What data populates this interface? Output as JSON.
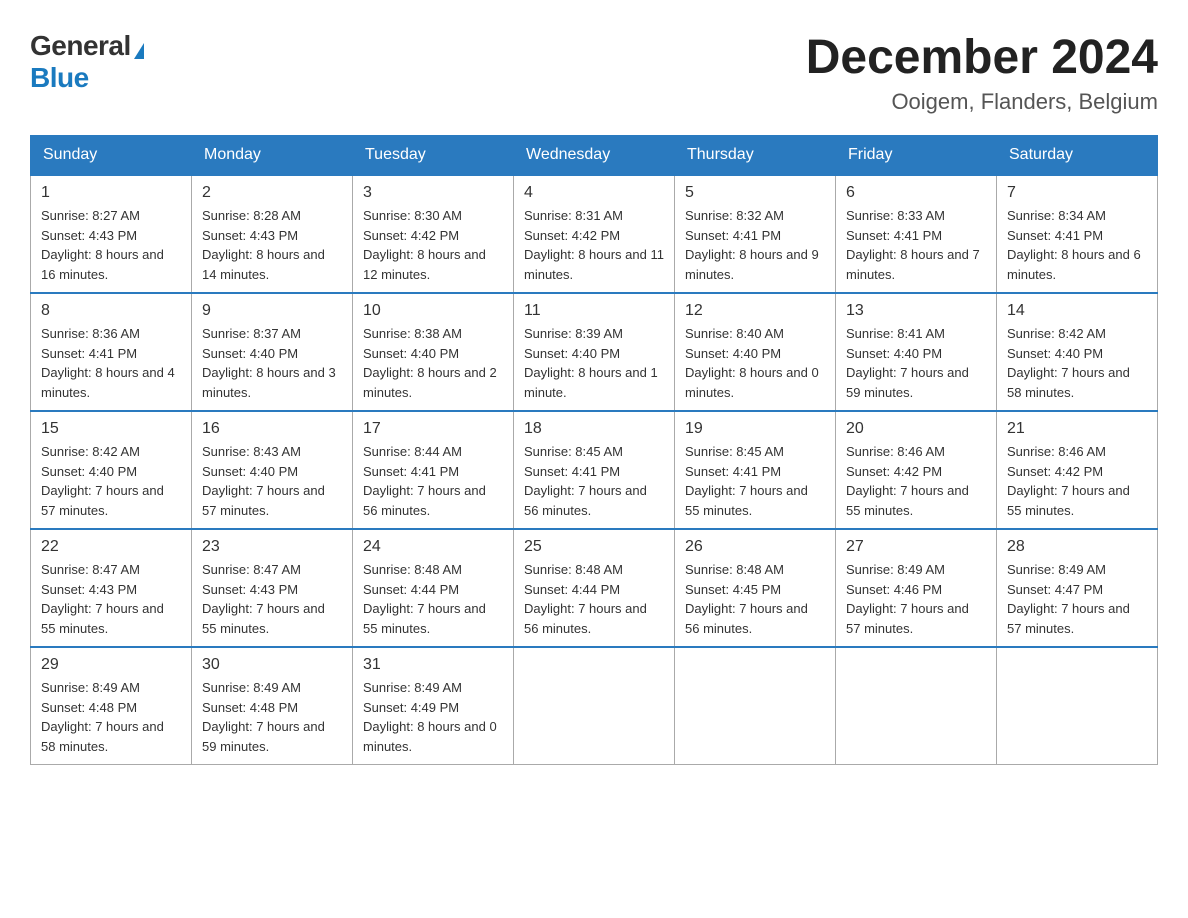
{
  "logo": {
    "general": "General",
    "blue": "Blue"
  },
  "header": {
    "title": "December 2024",
    "location": "Ooigem, Flanders, Belgium"
  },
  "weekdays": [
    "Sunday",
    "Monday",
    "Tuesday",
    "Wednesday",
    "Thursday",
    "Friday",
    "Saturday"
  ],
  "weeks": [
    [
      {
        "day": "1",
        "sunrise": "8:27 AM",
        "sunset": "4:43 PM",
        "daylight": "8 hours and 16 minutes."
      },
      {
        "day": "2",
        "sunrise": "8:28 AM",
        "sunset": "4:43 PM",
        "daylight": "8 hours and 14 minutes."
      },
      {
        "day": "3",
        "sunrise": "8:30 AM",
        "sunset": "4:42 PM",
        "daylight": "8 hours and 12 minutes."
      },
      {
        "day": "4",
        "sunrise": "8:31 AM",
        "sunset": "4:42 PM",
        "daylight": "8 hours and 11 minutes."
      },
      {
        "day": "5",
        "sunrise": "8:32 AM",
        "sunset": "4:41 PM",
        "daylight": "8 hours and 9 minutes."
      },
      {
        "day": "6",
        "sunrise": "8:33 AM",
        "sunset": "4:41 PM",
        "daylight": "8 hours and 7 minutes."
      },
      {
        "day": "7",
        "sunrise": "8:34 AM",
        "sunset": "4:41 PM",
        "daylight": "8 hours and 6 minutes."
      }
    ],
    [
      {
        "day": "8",
        "sunrise": "8:36 AM",
        "sunset": "4:41 PM",
        "daylight": "8 hours and 4 minutes."
      },
      {
        "day": "9",
        "sunrise": "8:37 AM",
        "sunset": "4:40 PM",
        "daylight": "8 hours and 3 minutes."
      },
      {
        "day": "10",
        "sunrise": "8:38 AM",
        "sunset": "4:40 PM",
        "daylight": "8 hours and 2 minutes."
      },
      {
        "day": "11",
        "sunrise": "8:39 AM",
        "sunset": "4:40 PM",
        "daylight": "8 hours and 1 minute."
      },
      {
        "day": "12",
        "sunrise": "8:40 AM",
        "sunset": "4:40 PM",
        "daylight": "8 hours and 0 minutes."
      },
      {
        "day": "13",
        "sunrise": "8:41 AM",
        "sunset": "4:40 PM",
        "daylight": "7 hours and 59 minutes."
      },
      {
        "day": "14",
        "sunrise": "8:42 AM",
        "sunset": "4:40 PM",
        "daylight": "7 hours and 58 minutes."
      }
    ],
    [
      {
        "day": "15",
        "sunrise": "8:42 AM",
        "sunset": "4:40 PM",
        "daylight": "7 hours and 57 minutes."
      },
      {
        "day": "16",
        "sunrise": "8:43 AM",
        "sunset": "4:40 PM",
        "daylight": "7 hours and 57 minutes."
      },
      {
        "day": "17",
        "sunrise": "8:44 AM",
        "sunset": "4:41 PM",
        "daylight": "7 hours and 56 minutes."
      },
      {
        "day": "18",
        "sunrise": "8:45 AM",
        "sunset": "4:41 PM",
        "daylight": "7 hours and 56 minutes."
      },
      {
        "day": "19",
        "sunrise": "8:45 AM",
        "sunset": "4:41 PM",
        "daylight": "7 hours and 55 minutes."
      },
      {
        "day": "20",
        "sunrise": "8:46 AM",
        "sunset": "4:42 PM",
        "daylight": "7 hours and 55 minutes."
      },
      {
        "day": "21",
        "sunrise": "8:46 AM",
        "sunset": "4:42 PM",
        "daylight": "7 hours and 55 minutes."
      }
    ],
    [
      {
        "day": "22",
        "sunrise": "8:47 AM",
        "sunset": "4:43 PM",
        "daylight": "7 hours and 55 minutes."
      },
      {
        "day": "23",
        "sunrise": "8:47 AM",
        "sunset": "4:43 PM",
        "daylight": "7 hours and 55 minutes."
      },
      {
        "day": "24",
        "sunrise": "8:48 AM",
        "sunset": "4:44 PM",
        "daylight": "7 hours and 55 minutes."
      },
      {
        "day": "25",
        "sunrise": "8:48 AM",
        "sunset": "4:44 PM",
        "daylight": "7 hours and 56 minutes."
      },
      {
        "day": "26",
        "sunrise": "8:48 AM",
        "sunset": "4:45 PM",
        "daylight": "7 hours and 56 minutes."
      },
      {
        "day": "27",
        "sunrise": "8:49 AM",
        "sunset": "4:46 PM",
        "daylight": "7 hours and 57 minutes."
      },
      {
        "day": "28",
        "sunrise": "8:49 AM",
        "sunset": "4:47 PM",
        "daylight": "7 hours and 57 minutes."
      }
    ],
    [
      {
        "day": "29",
        "sunrise": "8:49 AM",
        "sunset": "4:48 PM",
        "daylight": "7 hours and 58 minutes."
      },
      {
        "day": "30",
        "sunrise": "8:49 AM",
        "sunset": "4:48 PM",
        "daylight": "7 hours and 59 minutes."
      },
      {
        "day": "31",
        "sunrise": "8:49 AM",
        "sunset": "4:49 PM",
        "daylight": "8 hours and 0 minutes."
      },
      null,
      null,
      null,
      null
    ]
  ]
}
